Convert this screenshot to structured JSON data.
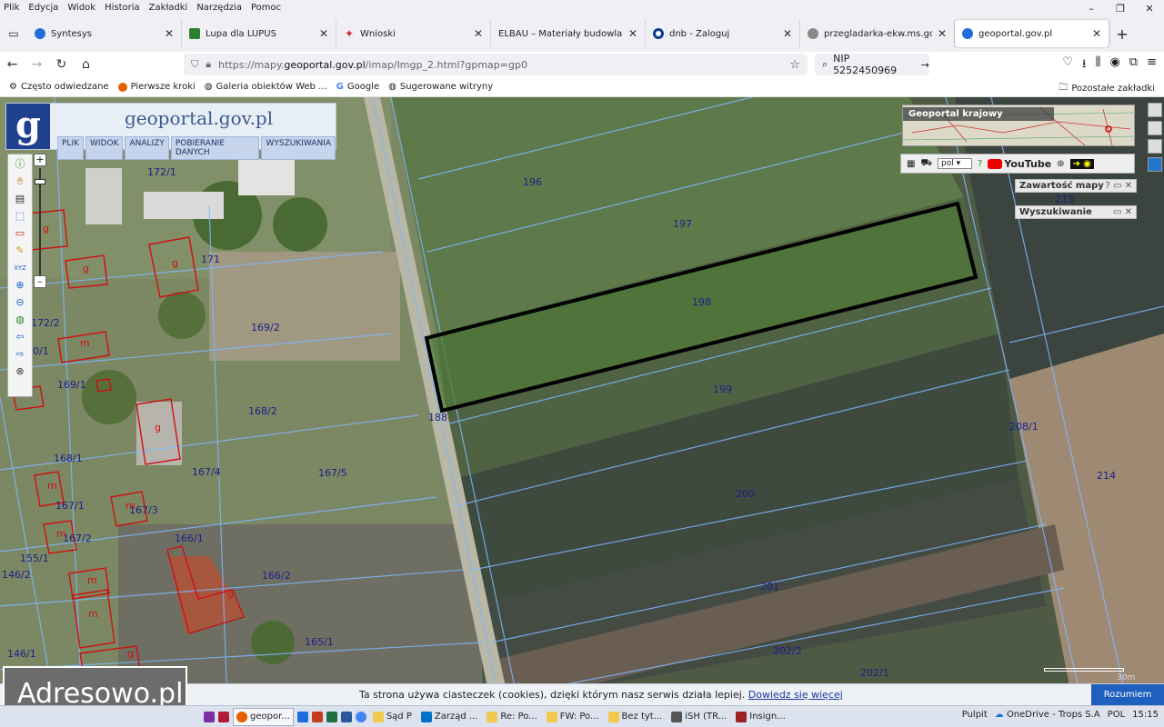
{
  "menubar": {
    "items": [
      "Plik",
      "Edycja",
      "Widok",
      "Historia",
      "Zakładki",
      "Narzędzia",
      "Pomoc"
    ]
  },
  "tabs": [
    {
      "label": "Syntesys",
      "color": "#1e6fd9"
    },
    {
      "label": "Lupa dla LUPUS",
      "color": "#2e7d32"
    },
    {
      "label": "Wnioski",
      "color": "#d32f2f"
    },
    {
      "label": "ELBAU – Materiały budowlane Pozn",
      "color": "#ffffff"
    },
    {
      "label": "dnb - Zaloguj",
      "color": "#0d3c8c"
    },
    {
      "label": "przegladarka-ekw.ms.gov.pl/eu",
      "color": "#777777"
    },
    {
      "label": "geoportal.gov.pl",
      "color": "#1e6fd9",
      "active": true
    }
  ],
  "navbar": {
    "url_prefix": "https://mapy.",
    "url_host": "geoportal.gov.pl",
    "url_rest": "/imap/Imgp_2.html?gpmap=gp0",
    "search_value": "NIP 5252450969"
  },
  "bookmarks": {
    "items": [
      "Często odwiedzane",
      "Pierwsze kroki",
      "Galeria obiektów Web ...",
      "Google",
      "Sugerowane witryny"
    ],
    "other": "Pozostałe zakładki"
  },
  "geoportal": {
    "logo_letter": "g",
    "logo_text": "geoportal.gov.pl",
    "menu": [
      "PLIK",
      "WIDOK",
      "ANALIZY",
      "POBIERANIE DANYCH",
      "WYSZUKIWANIA"
    ],
    "minimap_title": "Geoportal krajowy",
    "lang": "pol",
    "youtube": "YouTube",
    "panels": [
      "Zawartość mapy",
      "Wyszukiwanie"
    ],
    "scale_label": "30m"
  },
  "parcels": [
    "172/1",
    "171",
    "172/2",
    "169/2",
    "169/1",
    "168/2",
    "168/1",
    "167/4",
    "167/5",
    "167/1",
    "167/3",
    "167/2",
    "166/1",
    "166/2",
    "155/1",
    "146/2",
    "146/1",
    "165/1",
    "196",
    "197",
    "198",
    "199",
    "188",
    "200",
    "201",
    "202/2",
    "202/1",
    "208/1",
    "213",
    "214",
    "0/1"
  ],
  "building_marks": [
    "g",
    "g",
    "g",
    "g",
    "m",
    "g",
    "m",
    "m",
    "m",
    "m",
    "g",
    "m"
  ],
  "cookie": {
    "text": "Ta strona używa ciasteczek (cookies), dzięki którym nasz serwis działa lepiej.",
    "link": "Dowiedz się więcej",
    "button": "Rozumiem"
  },
  "watermark": "Adresowo.pl",
  "taskbar": {
    "items": [
      "geopor...",
      "Sąd P",
      "Zarząd ...",
      "Re: Po...",
      "FW: Po...",
      "Bez tyt...",
      "iSH (TR...",
      "Insign..."
    ],
    "tray": [
      "Pulpit",
      "OneDrive - Trops S.A",
      "POL",
      "15:15"
    ]
  }
}
